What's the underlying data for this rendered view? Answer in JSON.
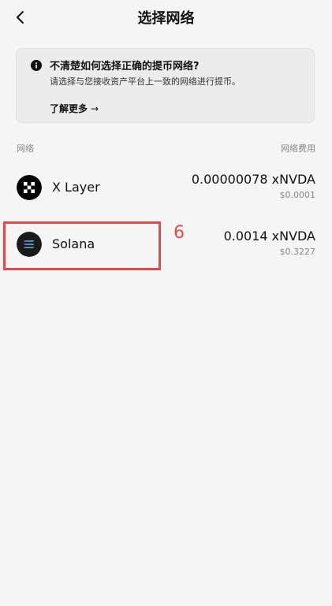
{
  "header": {
    "title": "选择网络",
    "back_icon": "chevron-left-icon"
  },
  "info_card": {
    "icon": "info-icon",
    "title": "不清楚如何选择正确的提币网络?",
    "description": "请选择与您接收资产平台上一致的网络进行提币。",
    "learn_more_label": "了解更多",
    "learn_more_arrow": "→"
  },
  "columns": {
    "network_label": "网络",
    "fee_label": "网络费用"
  },
  "networks": [
    {
      "name": "X Layer",
      "icon": "x-layer-logo-icon",
      "fee": "0.00000078 xNVDA",
      "fee_usd": "$0.0001"
    },
    {
      "name": "Solana",
      "icon": "solana-logo-icon",
      "fee": "0.0014 xNVDA",
      "fee_usd": "$0.3227"
    }
  ],
  "annotation": {
    "label": "6",
    "color": "#e04a4a"
  },
  "colors": {
    "background": "#f5f5f5",
    "card_background": "#ececec",
    "text_primary": "#111111",
    "text_secondary": "#888888"
  }
}
